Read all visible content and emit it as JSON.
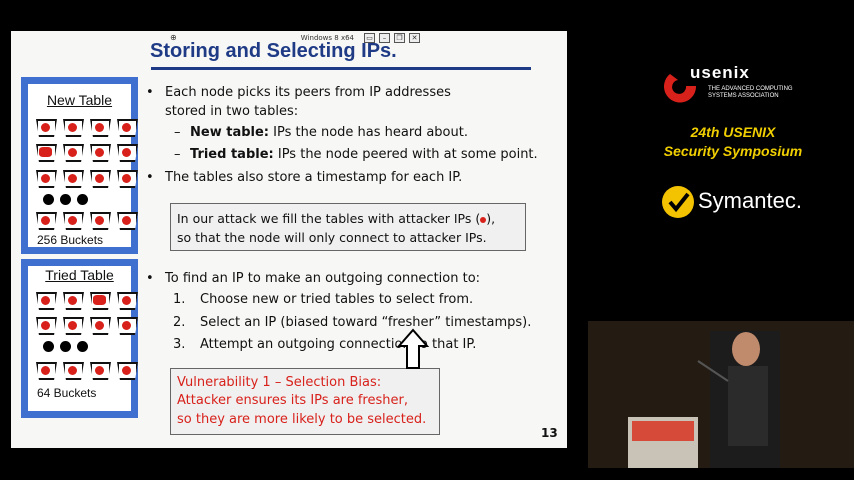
{
  "window": {
    "title": "Windows 8 x64"
  },
  "slide": {
    "title": "Storing and Selecting IPs.",
    "page_number": "13",
    "new_table": {
      "title": "New Table",
      "count": "256 Buckets"
    },
    "tried_table": {
      "title": "Tried Table",
      "count": "64 Buckets"
    },
    "bullets": {
      "b1_line1": "Each node picks its peers from IP addresses",
      "b1_line2": "stored in two tables:",
      "sub1_bold": "New table:",
      "sub1_rest": " IPs the node has heard about.",
      "sub2_bold": "Tried table:",
      "sub2_rest": " IPs the node peered with at some point.",
      "b2": "The tables also store a timestamp for each IP.",
      "b3": "To find an IP to make an outgoing connection to:",
      "n1_num": "1.",
      "n1": "Choose new or tried tables to select from.",
      "n2_num": "2.",
      "n2": "Select an IP (biased toward “fresher” timestamps).",
      "n3_num": "3.",
      "n3": "Attempt an outgoing connection to that IP."
    },
    "attack_box": {
      "line1_a": "In our attack we fill the tables with attacker IPs (",
      "line1_b": "),",
      "line2": "so that the node will only connect to attacker IPs."
    },
    "vuln_box": {
      "line1": "Vulnerability 1 – Selection Bias:",
      "line2": "Attacker ensures its IPs are fresher,",
      "line3": "so they are more likely to be selected."
    },
    "bullet_glyph": "•",
    "dash_glyph": "–"
  },
  "branding": {
    "usenix": "usenix",
    "usenix_sub": "THE ADVANCED COMPUTING SYSTEMS ASSOCIATION",
    "conference_line1": "24th USENIX",
    "conference_line2": "Security Symposium",
    "sponsor": "Symantec."
  },
  "colors": {
    "title": "#1f3b86",
    "panel": "#3f6fcf",
    "red": "#d8211b",
    "yellow": "#f2d000"
  }
}
